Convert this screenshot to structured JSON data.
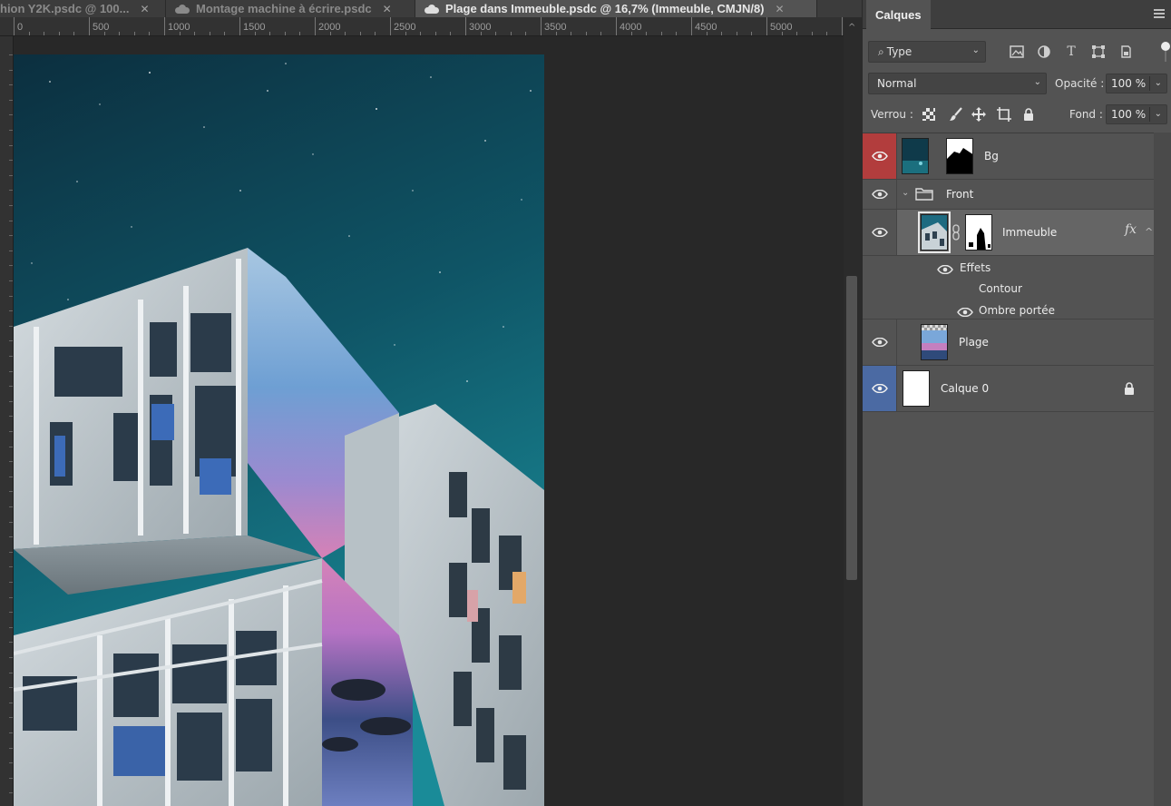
{
  "document_tabs": [
    {
      "label": "hion Y2K.psdc @ 100...",
      "active": false
    },
    {
      "label": "Montage machine à écrire.psdc",
      "active": false
    },
    {
      "label": "Plage dans Immeuble.psdc @ 16,7% (Immeuble, CMJN/8)",
      "active": true
    }
  ],
  "ruler": {
    "labels": [
      "0",
      "500",
      "1000",
      "1500",
      "2000",
      "2500",
      "3000",
      "3500",
      "4000",
      "4500",
      "5000"
    ]
  },
  "panel": {
    "title": "Calques",
    "filter": {
      "value": "Type"
    },
    "blend_mode": "Normal",
    "opacity_label": "Opacité :",
    "opacity_value": "100 %",
    "lock_label": "Verrou :",
    "fill_label": "Fond :",
    "fill_value": "100 %"
  },
  "layers": [
    {
      "name": "Bg",
      "eye_color": "red"
    },
    {
      "name": "Front",
      "type": "group"
    },
    {
      "name": "Immeuble",
      "selected": true,
      "fx": "fx",
      "effects_label": "Effets",
      "effects": [
        "Contour",
        "Ombre portée"
      ]
    },
    {
      "name": "Plage"
    },
    {
      "name": "Calque 0",
      "eye_color": "blue",
      "locked": true
    }
  ],
  "colors": {
    "accent_red": "#b23d3d",
    "accent_blue": "#4b6aa3",
    "panel_bg": "#535353",
    "workspace_bg": "#282828"
  }
}
